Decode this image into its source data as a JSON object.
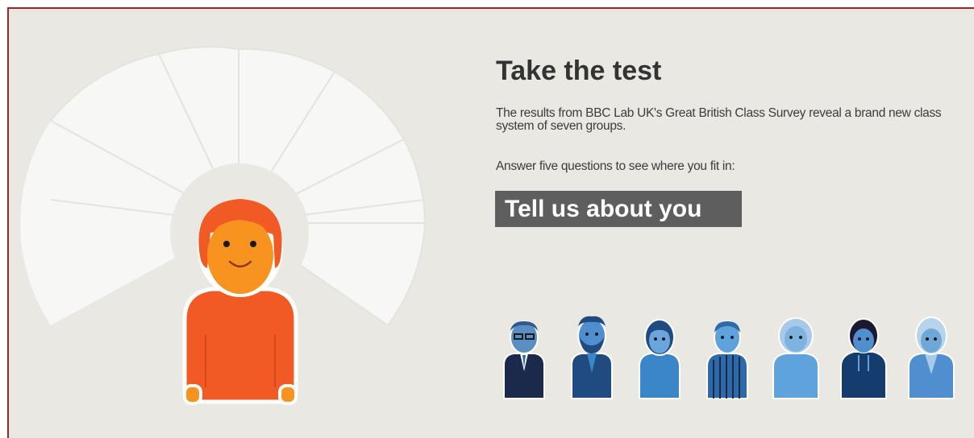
{
  "test": {
    "title": "Take the test",
    "intro": "The results from BBC Lab UK's Great British Class Survey reveal a brand new class system of seven groups.",
    "prompt": "Answer five questions to see where you fit in:",
    "cta_label": "Tell us about you"
  },
  "colors": {
    "frame_border": "#b01d25",
    "background": "#e9e8e3",
    "cta_background": "#5e5e5e",
    "avatar_orange": "#f15a24",
    "class_blues": [
      "#1b2a4a",
      "#1f4b80",
      "#3a86c8",
      "#2f6aa8",
      "#5fa3dc",
      "#163c6e",
      "#6fa8d6"
    ]
  },
  "illustration": {
    "main_figure": "orange-person-avatar",
    "class_groups": [
      {
        "icon": "bald-man-glasses-icon",
        "color": "#1b2a4a"
      },
      {
        "icon": "bearded-man-icon",
        "color": "#1f4b80"
      },
      {
        "icon": "woman-bob-hair-icon",
        "color": "#3a86c8"
      },
      {
        "icon": "man-striped-shirt-icon",
        "color": "#2f6aa8"
      },
      {
        "icon": "elderly-woman-icon",
        "color": "#5fa3dc"
      },
      {
        "icon": "young-man-hoodie-icon",
        "color": "#163c6e"
      },
      {
        "icon": "woman-jacket-icon",
        "color": "#6fa8d6"
      }
    ]
  }
}
